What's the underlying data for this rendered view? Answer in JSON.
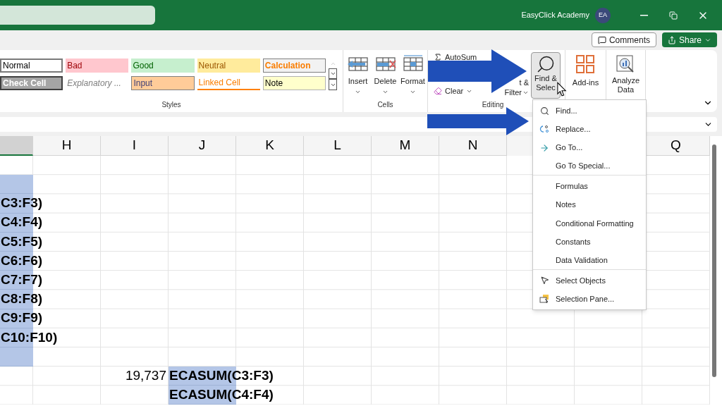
{
  "title_bar": {
    "account_name": "EasyClick Academy",
    "avatar_initials": "EA"
  },
  "header_buttons": [
    {
      "label": "Comments",
      "kind": "outline"
    },
    {
      "label": "Share",
      "kind": "primary"
    }
  ],
  "ribbon": {
    "styles": {
      "label": "Styles",
      "items": [
        {
          "label": "Normal",
          "kind": "normal"
        },
        {
          "label": "Bad",
          "kind": "bad"
        },
        {
          "label": "Good",
          "kind": "good"
        },
        {
          "label": "Neutral",
          "kind": "neutral"
        },
        {
          "label": "Calculation",
          "kind": "calculation"
        },
        {
          "label": "Check Cell",
          "kind": "check"
        },
        {
          "label": "Explanatory ...",
          "kind": "explanatory"
        },
        {
          "label": "Input",
          "kind": "input"
        },
        {
          "label": "Linked Cell",
          "kind": "linked"
        },
        {
          "label": "Note",
          "kind": "note"
        }
      ]
    },
    "cells": {
      "label": "Cells",
      "buttons": [
        {
          "label": "Insert",
          "kind": "insert"
        },
        {
          "label": "Delete",
          "kind": "delete"
        },
        {
          "label": "Format",
          "kind": "format"
        }
      ]
    },
    "editing": {
      "label": "Editing",
      "autosum": "AutoSum",
      "clear": "Clear",
      "sort_filter": [
        "t &",
        "Filter"
      ],
      "find_select": {
        "lines": [
          "Find &",
          "Selec"
        ],
        "selected": true
      }
    },
    "add_ins": "Add-ins",
    "analyze_data": [
      "Analyze",
      "Data"
    ]
  },
  "sheet": {
    "columns": [
      {
        "selected": true
      },
      {
        "label": "H",
        "selected": false
      },
      {
        "label": "I",
        "selected": false
      },
      {
        "label": "J",
        "selected": false
      },
      {
        "label": "K",
        "selected": false
      },
      {
        "label": "L",
        "selected": false
      },
      {
        "label": "M",
        "selected": false
      },
      {
        "label": "N",
        "selected": false
      },
      {
        "label": "Q",
        "selected": false
      }
    ],
    "rows": [
      {
        "column_1": {
          "selected": false
        }
      },
      {
        "column_1": {
          "selected": true
        }
      },
      {
        "column_1": {
          "text": "C3:F3)",
          "selected": true
        }
      },
      {
        "column_1": {
          "text": "C4:F4)",
          "selected": true
        }
      },
      {
        "column_1": {
          "text": "C5:F5)",
          "selected": true
        }
      },
      {
        "column_1": {
          "text": "C6:F6)",
          "selected": true
        }
      },
      {
        "column_1": {
          "text": "C7:F7)",
          "selected": true
        }
      },
      {
        "column_1": {
          "text": "C8:F8)",
          "selected": true
        }
      },
      {
        "column_1": {
          "text": "C9:F9)",
          "selected": true
        }
      },
      {
        "column_1": {
          "text": "C10:F10)",
          "selected": true
        }
      },
      {
        "column_1": {
          "selected": true
        }
      },
      {
        "column_1": {
          "selected": false
        },
        "I": {
          "text": "19,737",
          "selected": false
        },
        "J": {
          "text": "ECASUM(C3:F3)",
          "selected": true
        }
      },
      {
        "column_1": {
          "selected": false
        },
        "J": {
          "text": "ECASUM(C4:F4)",
          "selected": true
        }
      }
    ]
  },
  "find_menu": {
    "items": [
      {
        "label": "Find...",
        "kind": "search",
        "separator_after": false
      },
      {
        "label": "Replace...",
        "kind": "replace",
        "separator_after": false
      },
      {
        "label": "Go To...",
        "kind": "goto",
        "separator_after": false
      },
      {
        "label": "Go To Special...",
        "kind": "plain",
        "separator_after": true
      },
      {
        "label": "Formulas",
        "kind": "plain",
        "separator_after": false
      },
      {
        "label": "Notes",
        "kind": "plain",
        "separator_after": false
      },
      {
        "label": "Conditional Formatting",
        "kind": "plain",
        "separator_after": false
      },
      {
        "label": "Constants",
        "kind": "plain",
        "separator_after": false
      },
      {
        "label": "Data Validation",
        "kind": "plain",
        "separator_after": true
      },
      {
        "label": "Select Objects",
        "kind": "pointer",
        "separator_after": false
      },
      {
        "label": "Selection Pane...",
        "kind": "pane",
        "separator_after": false
      }
    ]
  }
}
